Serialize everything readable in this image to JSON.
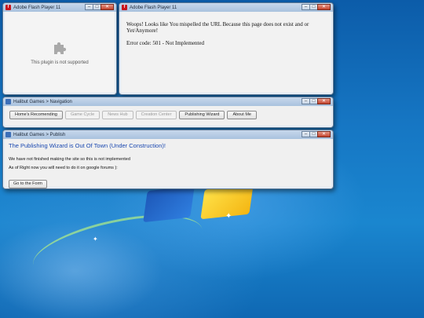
{
  "flash_window_1": {
    "title": "Adobe Flash Player 11",
    "message": "This plugin is not supported",
    "icon": "puzzle-piece-icon"
  },
  "flash_window_2": {
    "title": "Adobe Flash Player 11",
    "line1": "Woops! Looks like You mispelled the URL Because this page does not exist and or Yet/Anymore!",
    "error": "Error code: 501 - Not Implemented"
  },
  "nav_window": {
    "title": "Halibut Games > Navigation",
    "buttons": [
      {
        "label": "Home's Recomending",
        "enabled": true
      },
      {
        "label": "Game Cycle",
        "enabled": false
      },
      {
        "label": "News Hub",
        "enabled": false
      },
      {
        "label": "Creation Center",
        "enabled": false
      },
      {
        "label": "Publishing Wizard",
        "enabled": true
      },
      {
        "label": "About Me",
        "enabled": true
      }
    ]
  },
  "publish_window": {
    "title": "Halibut Games > Publish",
    "heading": "The Publishing Wizard is Out Of Town (Under Construction)!",
    "line1": "We have not finished making the site so this is not implemented",
    "line2": "As of Right now you will need to do it on google forums ):",
    "button": "Go to the Form"
  },
  "window_controls": {
    "minimize": "–",
    "maximize": "□",
    "close": "✕"
  },
  "colors": {
    "heading": "#1a48b0",
    "flash_icon": "#c8141c"
  }
}
